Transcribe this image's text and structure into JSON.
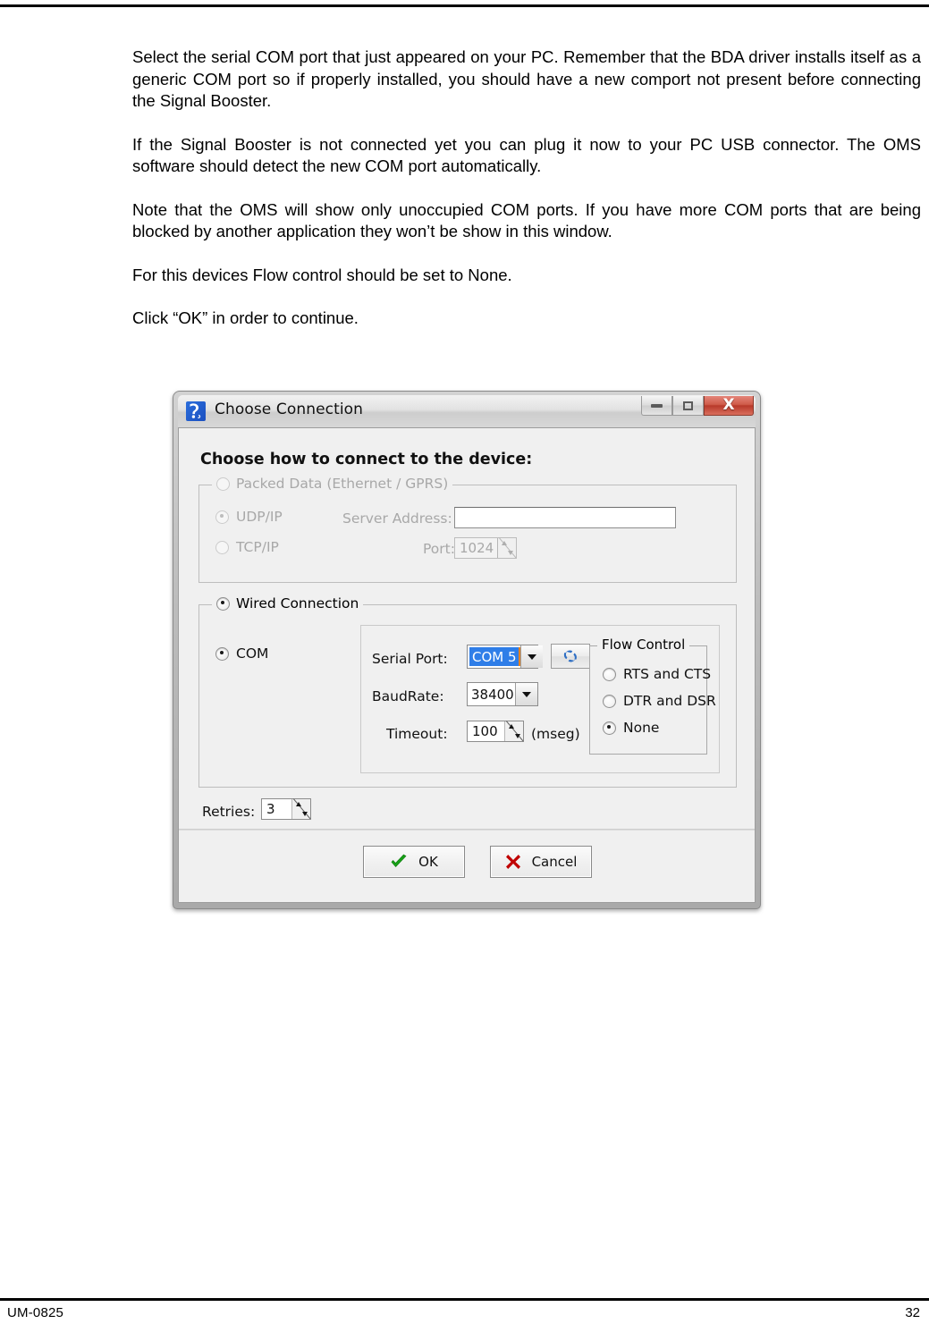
{
  "document": {
    "paragraphs": [
      "Select the serial COM port that just appeared on your PC. Remember that the BDA driver installs itself as a generic COM port so if properly installed, you should have a new comport not present before connecting the Signal Booster.",
      "If the Signal Booster is not connected yet you can plug it now to your PC USB connector.  The OMS software should detect the new COM port automatically.",
      "Note that the OMS will show only unoccupied COM ports.  If you have more COM ports that are being blocked by another application they won’t be show in this window.",
      "For this devices Flow control should be set to None.",
      "Click “OK” in order to continue."
    ],
    "footer": {
      "doc_number": "UM-0825",
      "page_number": "32"
    }
  },
  "dialog": {
    "title": "Choose Connection",
    "app_icon": "app-icon",
    "window_buttons": {
      "minimize": "–",
      "maximize": "□",
      "close": "X"
    },
    "heading": "Choose how to connect to the device:",
    "packed_data_group": {
      "legend": "Packed Data (Ethernet / GPRS)",
      "enabled": false,
      "selected": false,
      "options": [
        {
          "label": "UDP/IP",
          "selected": true
        },
        {
          "label": "TCP/IP",
          "selected": false
        }
      ],
      "server_address": {
        "label": "Server Address:",
        "value": "",
        "placeholder": ""
      },
      "port": {
        "label": "Port:",
        "value": "1024"
      }
    },
    "wired_group": {
      "legend": "Wired Connection",
      "selected": true,
      "com_option": {
        "label": "COM",
        "selected": true
      },
      "serial_port": {
        "label": "Serial Port:",
        "value": "COM 5",
        "options": [
          "COM 5"
        ]
      },
      "refresh_button": "refresh-icon",
      "baud_rate": {
        "label": "BaudRate:",
        "value": "38400",
        "options": [
          "38400"
        ]
      },
      "timeout": {
        "label": "Timeout:",
        "value": "100",
        "units": "(mseg)"
      },
      "flow_control": {
        "legend": "Flow Control",
        "options": [
          {
            "label": "RTS and CTS",
            "selected": false
          },
          {
            "label": "DTR and DSR",
            "selected": false
          },
          {
            "label": "None",
            "selected": true
          }
        ]
      }
    },
    "retries": {
      "label": "Retries:",
      "value": "3"
    },
    "buttons": {
      "ok": "OK",
      "cancel": "Cancel"
    },
    "colors": {
      "selection_blue": "#2f7ee8",
      "close_red": "#b8392a",
      "ok_green": "#17a017",
      "cancel_red": "#c00000",
      "app_icon_blue": "#1a4fc0",
      "dialog_face": "#f0f0f0"
    }
  }
}
